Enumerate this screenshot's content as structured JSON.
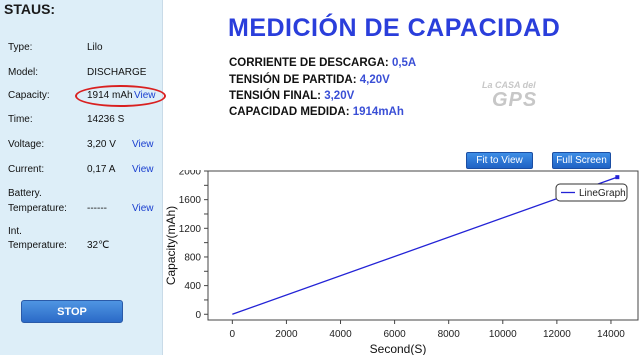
{
  "status": {
    "title": "STAUS:",
    "rows": [
      {
        "label": "Type:",
        "value": "Lilo"
      },
      {
        "label": "Model:",
        "value": "DISCHARGE"
      },
      {
        "label": "Capacity:",
        "value": "1914 mAh",
        "link": "View"
      },
      {
        "label": "Time:",
        "value": "14236 S"
      },
      {
        "label": "Voltage:",
        "value": "3,20 V",
        "link": "View"
      },
      {
        "label": "Current:",
        "value": "0,17 A",
        "link": "View"
      },
      {
        "label1": "Battery.",
        "label2": "Temperature:",
        "value": "------",
        "link": "View"
      },
      {
        "label1": "Int.",
        "label2": "Temperature:",
        "value": "32℃"
      }
    ],
    "stop_label": "STOP"
  },
  "main": {
    "title": "MEDICIÓN DE CAPACIDAD",
    "info": [
      {
        "label": "CORRIENTE DE DESCARGA: ",
        "value": "0,5A"
      },
      {
        "label": "TENSIÓN DE PARTIDA: ",
        "value": "4,20V"
      },
      {
        "label": "TENSIÓN FINAL: ",
        "value": "3,20V"
      },
      {
        "label": "CAPACIDAD MEDIDA: ",
        "value": "1914mAh"
      }
    ],
    "logo_line1": "La CASA del",
    "logo_line2": "GPS"
  },
  "toolbar": {
    "fit_label": "Fit to View",
    "fullscreen_label": "Full Screen"
  },
  "colors": {
    "accent": "#2a3edb",
    "line": "#2323d6",
    "highlight_circle": "#d92020"
  },
  "chart_data": {
    "type": "line",
    "xlabel": "Second(S)",
    "ylabel": "Capacity(mAh)",
    "x_ticks": [
      0,
      2000,
      4000,
      6000,
      8000,
      10000,
      12000,
      14000
    ],
    "y_ticks": [
      0,
      200,
      400,
      600,
      800,
      1000,
      1200,
      1400,
      1600,
      1800,
      2000
    ],
    "y_tick_labels": [
      "0",
      "",
      "400",
      "",
      "800",
      "",
      "1200",
      "",
      "1600",
      "",
      "2000"
    ],
    "xlim": [
      -900,
      15000
    ],
    "ylim": [
      -80,
      2000
    ],
    "grid": false,
    "legend_position": "top-right",
    "series": [
      {
        "name": "LineGraph",
        "x": [
          0,
          14236
        ],
        "y": [
          0,
          1914
        ]
      }
    ]
  }
}
